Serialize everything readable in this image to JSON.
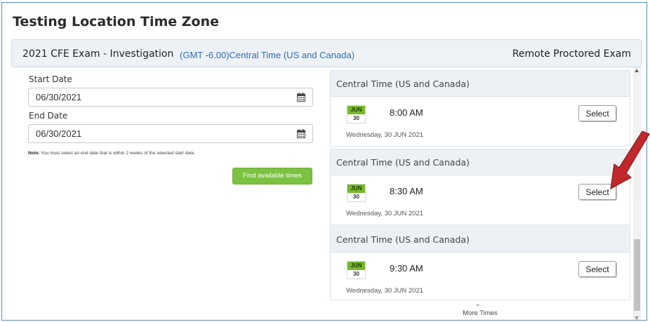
{
  "page_title": "Testing Location Time Zone",
  "exam": {
    "name": "2021 CFE Exam - Investigation",
    "timezone": "(GMT -6.00)Central Time (US and Canada)",
    "type": "Remote Proctored Exam"
  },
  "form": {
    "start_label": "Start Date",
    "start_value": "06/30/2021",
    "end_label": "End Date",
    "end_value": "06/30/2021",
    "note_label": "Note:",
    "note_text": " You must select an end date that is within 2 weeks of the selected start date.",
    "find_button": "Find available times"
  },
  "slots": [
    {
      "zone": "Central Time (US and Canada)",
      "month": "JUN",
      "day": "30",
      "time": "8:00 AM",
      "date": "Wednesday, 30 JUN 2021",
      "button": "Select"
    },
    {
      "zone": "Central Time (US and Canada)",
      "month": "JUN",
      "day": "30",
      "time": "8:30 AM",
      "date": "Wednesday, 30 JUN 2021",
      "button": "Select"
    },
    {
      "zone": "Central Time (US and Canada)",
      "month": "JUN",
      "day": "30",
      "time": "9:30 AM",
      "date": "Wednesday, 30 JUN 2021",
      "button": "Select"
    }
  ],
  "more": {
    "chevron": "⌄",
    "label": "More Times"
  },
  "colors": {
    "accent_green": "#7cc242",
    "link_blue": "#2f6db5",
    "annotation_arrow": "#c0282b"
  },
  "icons": {
    "calendar": "calendar-icon",
    "annotation": "red-arrow-annotation"
  }
}
